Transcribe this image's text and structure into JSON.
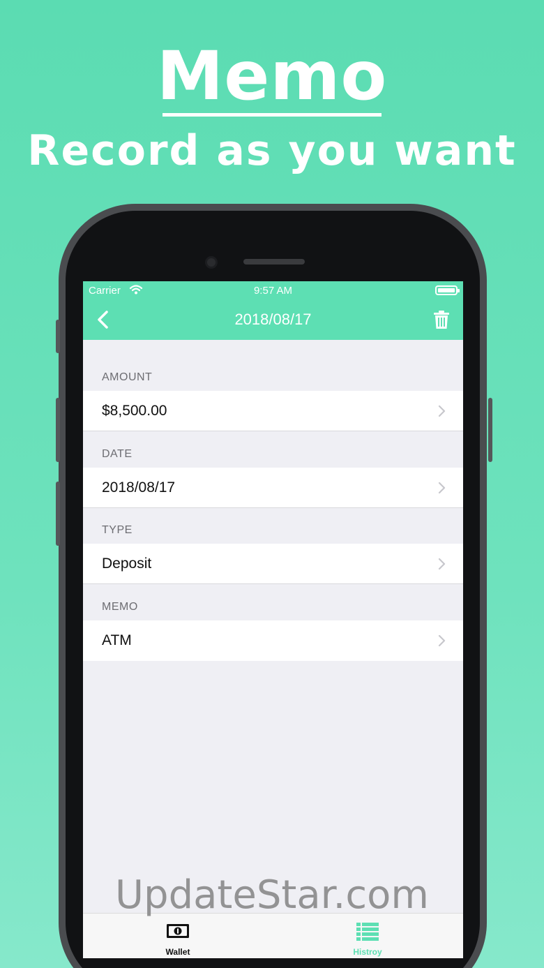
{
  "hero": {
    "title": "Memo",
    "subtitle": "Record as you want"
  },
  "status_bar": {
    "carrier": "Carrier",
    "time": "9:57 AM"
  },
  "nav": {
    "title": "2018/08/17",
    "back_icon": "chevron-left-icon",
    "delete_icon": "trash-icon"
  },
  "sections": [
    {
      "header": "AMOUNT",
      "value": "$8,500.00"
    },
    {
      "header": "DATE",
      "value": "2018/08/17"
    },
    {
      "header": "TYPE",
      "value": "Deposit"
    },
    {
      "header": "MEMO",
      "value": "ATM"
    }
  ],
  "tabs": [
    {
      "label": "Wallet",
      "icon": "wallet-icon",
      "active": false
    },
    {
      "label": "Histroy",
      "icon": "list-icon",
      "active": true
    }
  ],
  "watermark": "UpdateStar.com",
  "colors": {
    "accent": "#5ddfb3",
    "tab_inactive": "#111111",
    "tab_active": "#5ddfb3"
  }
}
